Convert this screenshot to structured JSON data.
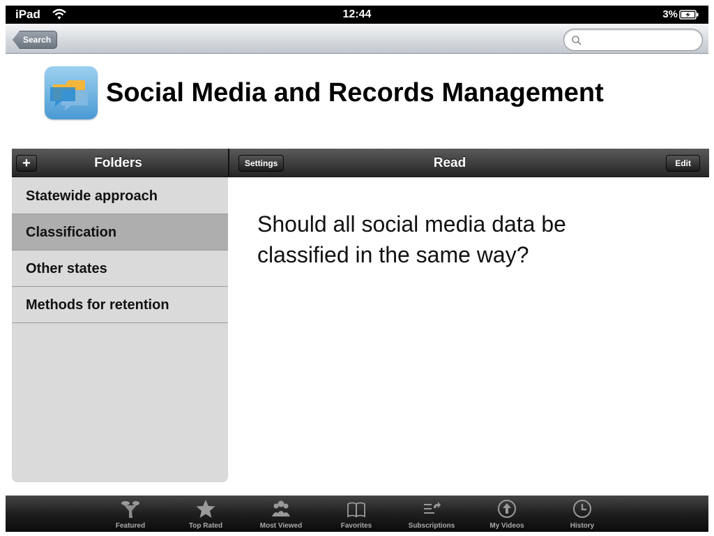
{
  "status_bar": {
    "device": "iPad",
    "time": "12:44",
    "battery": "3%"
  },
  "nav_bar": {
    "back_label": "Search",
    "search_placeholder": ""
  },
  "header": {
    "title": "Social Media and Records Management",
    "logo_icon": "chat-bubbles-icon"
  },
  "left_pane": {
    "title": "Folders",
    "add_label": "+",
    "folders": [
      {
        "label": "Statewide approach"
      },
      {
        "label": "Classification"
      },
      {
        "label": "Other states"
      },
      {
        "label": "Methods for retention"
      }
    ],
    "selected_index": 1
  },
  "right_pane": {
    "settings_label": "Settings",
    "title": "Read",
    "edit_label": "Edit",
    "content": "Should all social media data be classified in the same way?"
  },
  "tab_bar": {
    "tabs": [
      {
        "label": "Featured",
        "icon": "featured-icon"
      },
      {
        "label": "Top Rated",
        "icon": "star-icon"
      },
      {
        "label": "Most Viewed",
        "icon": "people-icon"
      },
      {
        "label": "Favorites",
        "icon": "book-icon"
      },
      {
        "label": "Subscriptions",
        "icon": "subscriptions-icon"
      },
      {
        "label": "My Videos",
        "icon": "upload-icon"
      },
      {
        "label": "History",
        "icon": "clock-icon"
      }
    ]
  },
  "colors": {
    "toolbar": "#262626",
    "selected_row": "#aeaeae",
    "sidebar": "#dadada",
    "tab_label": "#a9a9a9"
  }
}
